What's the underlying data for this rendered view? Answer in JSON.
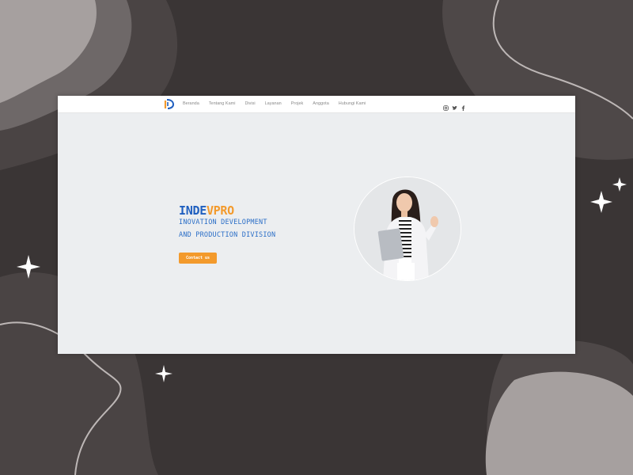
{
  "nav": {
    "items": [
      "Beranda",
      "Tentang Kami",
      "Divisi",
      "Layanan",
      "Projek",
      "Anggota",
      "Hubungi Kami"
    ]
  },
  "social": [
    "instagram-icon",
    "twitter-icon",
    "facebook-icon"
  ],
  "hero": {
    "brand_part1": "INDE",
    "brand_part2": "VPRO",
    "tagline_line1": "INOVATION DEVELOPMENT",
    "tagline_line2": "AND PRODUCTION DIVISION",
    "cta_label": "Contact us"
  },
  "colors": {
    "brand_blue": "#1f5fbf",
    "brand_orange": "#f39a2c",
    "site_bg": "#eceef0",
    "backdrop": "#3a3535"
  }
}
